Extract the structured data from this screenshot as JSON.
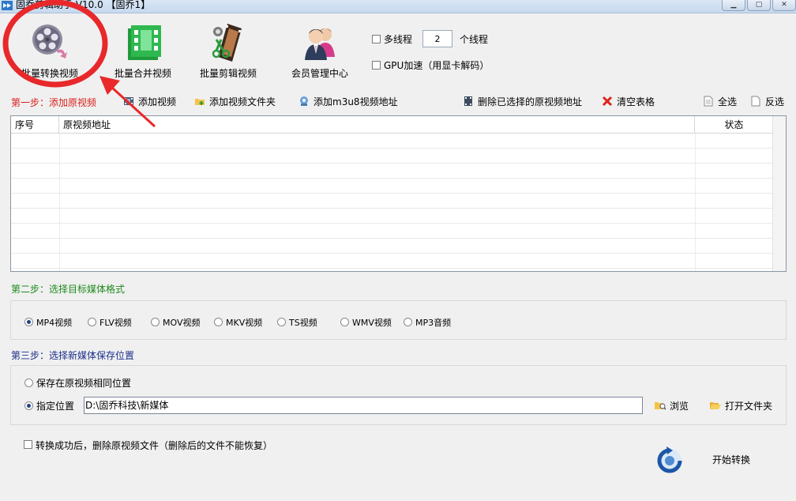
{
  "window": {
    "title": "固乔剪辑助手 V10.0 【固乔1】",
    "min_icon": "minimize-icon",
    "max_icon": "maximize-icon",
    "close_icon": "close-icon"
  },
  "toolbar": {
    "batch_convert": "批量转换视频",
    "batch_merge": "批量合并视频",
    "batch_cut": "批量剪辑视频",
    "member_center": "会员管理中心"
  },
  "options": {
    "multithread_label": "多线程",
    "multithread_checked": false,
    "thread_count": "2",
    "thread_unit": "个线程",
    "gpu_label": "GPU加速（用显卡解码）",
    "gpu_checked": false
  },
  "step1": {
    "label": "第一步：添加原视频",
    "add_video": "添加视频",
    "add_folder": "添加视频文件夹",
    "add_m3u8": "添加m3u8视频地址",
    "delete_selected": "删除已选择的原视频地址",
    "clear_table": "清空表格",
    "select_all": "全选",
    "invert_select": "反选"
  },
  "table": {
    "columns": [
      "序号",
      "原视频地址",
      "状态"
    ],
    "rows": []
  },
  "step2": {
    "label": "第二步：选择目标媒体格式",
    "formats": [
      "MP4视频",
      "FLV视频",
      "MOV视频",
      "MKV视频",
      "TS视频",
      "WMV视频",
      "MP3音频"
    ],
    "selected": "MP4视频"
  },
  "step3": {
    "label": "第三步：选择新媒体保存位置",
    "same_location": "保存在原视频相同位置",
    "custom_location": "指定位置",
    "selected": "指定位置",
    "path": "D:\\固乔科技\\新媒体",
    "browse": "浏览",
    "open_folder": "打开文件夹"
  },
  "footer": {
    "delete_source_label": "转换成功后，删除原视频文件（删除后的文件不能恢复）",
    "delete_source_checked": false,
    "start": "开始转换"
  },
  "colors": {
    "step1": "#d8201c",
    "step2": "#1e8a1e",
    "step3": "#1b2f8a",
    "annotation": "#e8282a"
  }
}
